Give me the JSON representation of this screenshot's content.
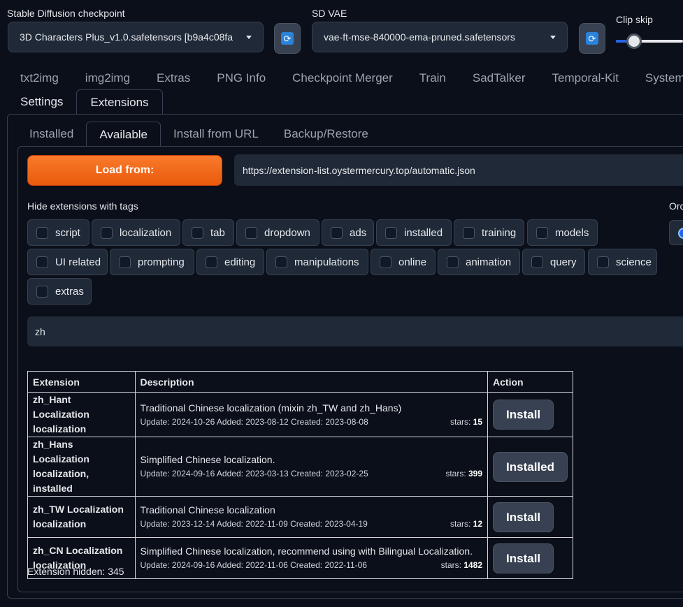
{
  "settings_bar": {
    "checkpoint_label": "Stable Diffusion checkpoint",
    "checkpoint_value": "3D Characters Plus_v1.0.safetensors [b9a4c08fa",
    "vae_label": "SD VAE",
    "vae_value": "vae-ft-mse-840000-ema-pruned.safetensors",
    "clip_skip_label": "Clip skip",
    "refresh_icon": "refresh-icon"
  },
  "main_tabs": [
    "txt2img",
    "img2img",
    "Extras",
    "PNG Info",
    "Checkpoint Merger",
    "Train",
    "SadTalker",
    "Temporal-Kit",
    "System Info"
  ],
  "sub_tabs": [
    "Settings",
    "Extensions"
  ],
  "extension_tabs": [
    "Installed",
    "Available",
    "Install from URL",
    "Backup/Restore"
  ],
  "available": {
    "load_button": "Load from:",
    "url": "https://extension-list.oystermercury.top/automatic.json",
    "hide_label": "Hide extensions with tags",
    "order_label": "Orc",
    "tags": [
      "script",
      "localization",
      "tab",
      "dropdown",
      "ads",
      "installed",
      "training",
      "models",
      "UI related",
      "prompting",
      "editing",
      "manipulations",
      "online",
      "animation",
      "query",
      "science",
      "extras"
    ],
    "search_value": "zh",
    "table": {
      "headers": [
        "Extension",
        "Description",
        "Action"
      ],
      "rows": [
        {
          "name": "zh_Hant Localization",
          "tags": "localization",
          "description": "Traditional Chinese localization (mixin zh_TW and zh_Hans)",
          "meta": "Update: 2024-10-26 Added: 2023-08-12 Created: 2023-08-08",
          "stars_label": "stars:",
          "stars": "15",
          "action": "Install"
        },
        {
          "name": "zh_Hans Localization",
          "tags": "localization, installed",
          "description": "Simplified Chinese localization.",
          "meta": "Update: 2024-09-16 Added: 2023-03-13 Created: 2023-02-25",
          "stars_label": "stars:",
          "stars": "399",
          "action": "Installed"
        },
        {
          "name": "zh_TW Localization",
          "tags": "localization",
          "description": "Traditional Chinese localization",
          "meta": "Update: 2023-12-14 Added: 2022-11-09 Created: 2023-04-19",
          "stars_label": "stars:",
          "stars": "12",
          "action": "Install"
        },
        {
          "name": "zh_CN Localization",
          "tags": "localization",
          "description": "Simplified Chinese localization, recommend using with Bilingual Localization.",
          "meta": "Update: 2024-09-16 Added: 2022-11-06 Created: 2022-11-06",
          "stars_label": "stars:",
          "stars": "1482",
          "action": "Install"
        }
      ]
    },
    "hidden_count": "Extension hidden: 345"
  },
  "colors": {
    "background": "#0b0f19",
    "accent_orange": "#f97316",
    "accent_blue": "#2563eb"
  }
}
